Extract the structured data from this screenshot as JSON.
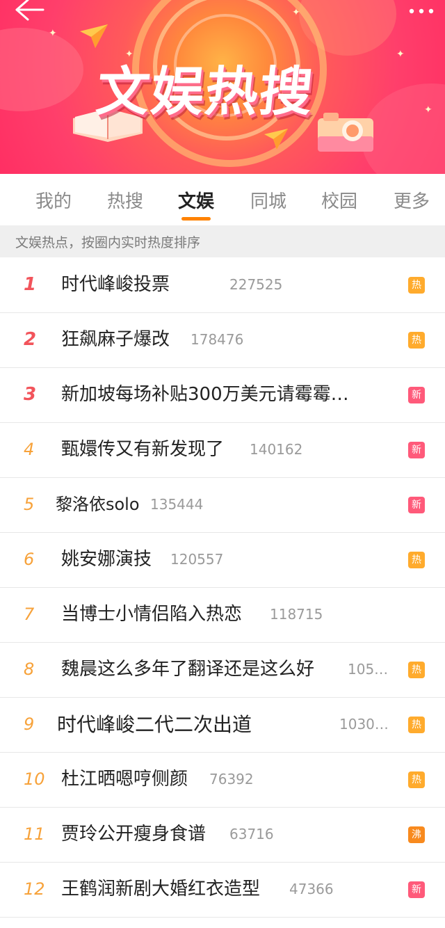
{
  "banner": {
    "title": "文娱热搜",
    "back_icon": "back-arrow-icon",
    "more_icon": "more-dots-icon"
  },
  "tabs": [
    {
      "label": "我的",
      "active": false
    },
    {
      "label": "热搜",
      "active": false
    },
    {
      "label": "文娱",
      "active": true
    },
    {
      "label": "同城",
      "active": false
    },
    {
      "label": "校园",
      "active": false
    },
    {
      "label": "更多",
      "active": false
    }
  ],
  "hint": "文娱热点，按圈内实时热度排序",
  "colors": {
    "accent": "#ff8200",
    "rank_top": "#f2545b",
    "rank_normal": "#f7a23a",
    "badge_hot": "#ffab2d",
    "badge_new": "#ff5a7a",
    "badge_boil": "#f88a1e"
  },
  "items": [
    {
      "rank": "1",
      "keyword": "时代峰峻投票",
      "count": "227525",
      "badge": "热",
      "badge_type": "hot"
    },
    {
      "rank": "2",
      "keyword": "狂飙麻子爆改",
      "count": "178476",
      "badge": "热",
      "badge_type": "hot"
    },
    {
      "rank": "3",
      "keyword": "新加坡每场补贴300万美元请霉霉…",
      "count": "",
      "badge": "新",
      "badge_type": "new"
    },
    {
      "rank": "4",
      "keyword": "甄嬛传又有新发现了",
      "count": "140162",
      "badge": "新",
      "badge_type": "new"
    },
    {
      "rank": "5",
      "keyword": "黎洛依solo",
      "count": "135444",
      "badge": "新",
      "badge_type": "new"
    },
    {
      "rank": "6",
      "keyword": "姚安娜演技",
      "count": "120557",
      "badge": "热",
      "badge_type": "hot"
    },
    {
      "rank": "7",
      "keyword": "当博士小情侣陷入热恋",
      "count": "118715",
      "badge": "",
      "badge_type": ""
    },
    {
      "rank": "8",
      "keyword": "魏晨这么多年了翻译还是这么好",
      "count": "105…",
      "badge": "热",
      "badge_type": "hot"
    },
    {
      "rank": "9",
      "keyword": "时代峰峻二代二次出道",
      "count": "1030…",
      "badge": "热",
      "badge_type": "hot"
    },
    {
      "rank": "10",
      "keyword": "杜江晒嗯哼侧颜",
      "count": "76392",
      "badge": "热",
      "badge_type": "hot"
    },
    {
      "rank": "11",
      "keyword": "贾玲公开瘦身食谱",
      "count": "63716",
      "badge": "沸",
      "badge_type": "boil"
    },
    {
      "rank": "12",
      "keyword": "王鹤润新剧大婚红衣造型",
      "count": "47366",
      "badge": "新",
      "badge_type": "new"
    }
  ]
}
